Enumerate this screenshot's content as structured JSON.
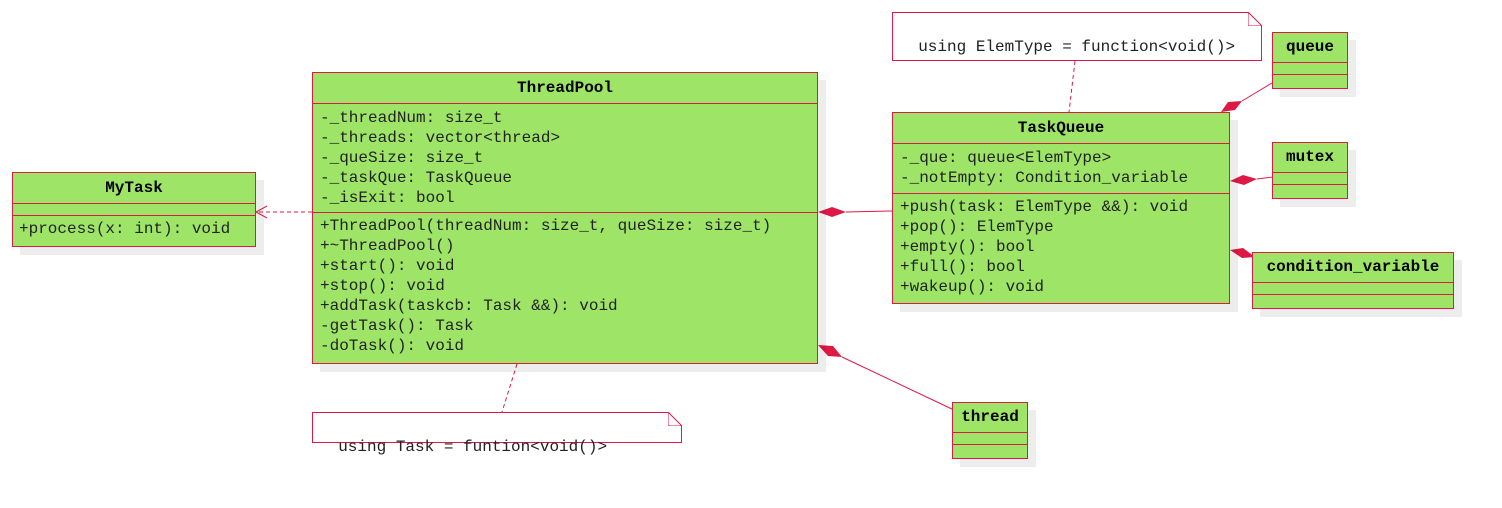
{
  "classes": {
    "mytask": {
      "name": "MyTask",
      "attributes": [],
      "methods": [
        "+process(x: int): void"
      ]
    },
    "threadpool": {
      "name": "ThreadPool",
      "attributes": [
        "-_threadNum: size_t",
        "-_threads: vector<thread>",
        "-_queSize: size_t",
        "-_taskQue: TaskQueue",
        "-_isExit: bool"
      ],
      "methods": [
        "+ThreadPool(threadNum: size_t, queSize: size_t)",
        "+~ThreadPool()",
        "+start(): void",
        "+stop(): void",
        "+addTask(taskcb: Task &&): void",
        "-getTask(): Task",
        "-doTask(): void"
      ]
    },
    "taskqueue": {
      "name": "TaskQueue",
      "attributes": [
        "-_que: queue<ElemType>",
        "-_notEmpty: Condition_variable"
      ],
      "methods": [
        "+push(task: ElemType &&): void",
        "+pop(): ElemType",
        "+empty(): bool",
        "+full(): bool",
        "+wakeup(): void"
      ]
    },
    "queue": {
      "name": "queue"
    },
    "mutex": {
      "name": "mutex"
    },
    "condition_variable": {
      "name": "condition_variable"
    },
    "thread": {
      "name": "thread"
    }
  },
  "notes": {
    "elemtype": "using ElemType = function<void()>",
    "task": "using Task = funtion<void()>"
  },
  "relations": [
    {
      "from": "ThreadPool",
      "to": "MyTask",
      "type": "dependency"
    },
    {
      "from": "ThreadPool",
      "to": "TaskQueue",
      "type": "composition"
    },
    {
      "from": "ThreadPool",
      "to": "thread",
      "type": "composition"
    },
    {
      "from": "TaskQueue",
      "to": "queue",
      "type": "composition"
    },
    {
      "from": "TaskQueue",
      "to": "mutex",
      "type": "composition"
    },
    {
      "from": "TaskQueue",
      "to": "condition_variable",
      "type": "composition"
    }
  ],
  "colors": {
    "class_fill": "#9ee567",
    "border": "#dd1a45",
    "note_fill": "#ffffff"
  }
}
